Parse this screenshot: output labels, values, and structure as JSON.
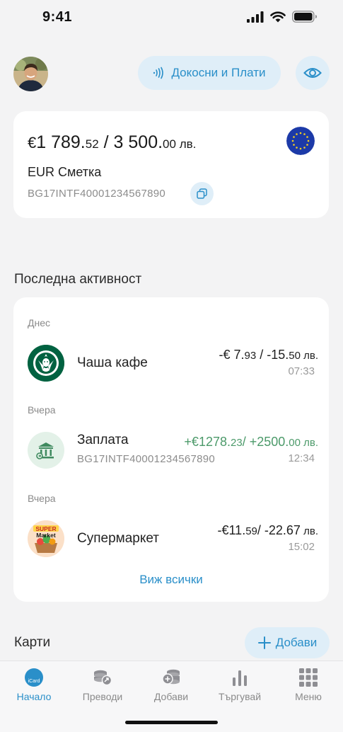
{
  "status_bar": {
    "time": "9:41"
  },
  "header": {
    "nfc_button_label": "Докосни и Плати"
  },
  "account": {
    "balance_eur_symbol": "€",
    "balance_eur_int": "1 789.",
    "balance_eur_dec": "52",
    "separator": " / ",
    "balance_bgn_int": "3 500.",
    "balance_bgn_dec": "00",
    "balance_bgn_unit": " лв.",
    "name": "EUR Сметка",
    "iban": "BG17INTF40001234567890"
  },
  "activity": {
    "title": "Последна активност",
    "view_all": "Виж всички",
    "groups": [
      {
        "day": "Днес",
        "tx": {
          "name": "Чаша кафе",
          "amount_main": "-€ 7.",
          "amount_dec": "93",
          "amount_sep": " / -15.",
          "amount_dec2": "50",
          "amount_unit": " лв.",
          "time": "07:33",
          "icon": "starbucks-logo"
        }
      },
      {
        "day": "Вчера",
        "tx": {
          "name": "Заплата",
          "sub": "BG17INTF40001234567890",
          "amount_main": "+€1278.",
          "amount_dec": "23",
          "amount_sep": "/ +2500.",
          "amount_dec2": "00",
          "amount_unit": " лв.",
          "time": "12:34",
          "icon": "bank-icon"
        }
      },
      {
        "day": "Вчера",
        "tx": {
          "name": "Супермаркет",
          "amount_main": "-€11.",
          "amount_dec": "59",
          "amount_sep": "/ -22.67",
          "amount_dec2": "",
          "amount_unit": " лв.",
          "time": "15:02",
          "icon": "supermarket-logo",
          "logo_text_1": "SUPER",
          "logo_text_2": "Market"
        }
      }
    ]
  },
  "cards": {
    "title": "Карти",
    "add_label": "Добави"
  },
  "nav": {
    "items": [
      {
        "label": "Начало",
        "active": true,
        "icon": "icard-icon",
        "icon_text": "iCard"
      },
      {
        "label": "Преводи",
        "icon": "transfer-icon"
      },
      {
        "label": "Добави",
        "icon": "add-money-icon"
      },
      {
        "label": "Търгувай",
        "icon": "chart-bars-icon"
      },
      {
        "label": "Меню",
        "icon": "grid-menu-icon"
      }
    ]
  },
  "colors": {
    "accent": "#2a8fc9",
    "accent_bg": "#dfeef8",
    "positive": "#4c9a6a",
    "background": "#f3f3f4"
  }
}
